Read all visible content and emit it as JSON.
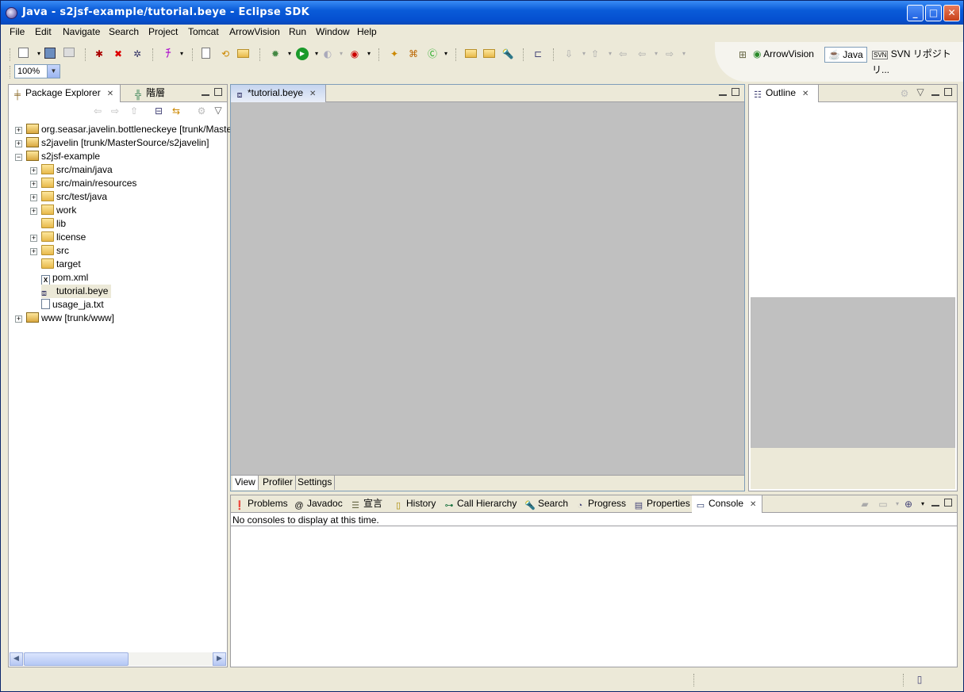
{
  "window": {
    "title": "Java - s2jsf-example/tutorial.beye - Eclipse SDK",
    "minimize": "_",
    "maximize": "□",
    "close": "✕"
  },
  "menu": [
    {
      "label": "File",
      "key": "F",
      "rest": "ile"
    },
    {
      "label": "Edit",
      "key": "E",
      "rest": "dit"
    },
    {
      "label": "Navigate",
      "key": "N",
      "rest": "avigate"
    },
    {
      "label": "Search",
      "key": "a",
      "pre": "Se",
      "rest": "rch"
    },
    {
      "label": "Project",
      "key": "P",
      "rest": "roject"
    },
    {
      "label": "Tomcat",
      "key": "T",
      "rest": "omcat"
    },
    {
      "label": "ArrowVision",
      "key": "",
      "rest": "ArrowVision"
    },
    {
      "label": "Run",
      "key": "R",
      "rest": "un"
    },
    {
      "label": "Window",
      "key": "W",
      "rest": "indow"
    },
    {
      "label": "Help",
      "key": "H",
      "rest": "elp"
    }
  ],
  "toolbar": {
    "zoom_value": "100%",
    "perspectives": {
      "arrowvision": "ArrowVision",
      "java": "Java",
      "svn": "SVN リポジトリ..."
    }
  },
  "package_explorer": {
    "tab_label": "Package Explorer",
    "hierarchy_tab_label": "階層",
    "tree": [
      {
        "label": "org.seasar.javelin.bottleneckeye [trunk/Maste",
        "expander": "+",
        "icon": "project"
      },
      {
        "label": "s2javelin [trunk/MasterSource/s2javelin]",
        "expander": "+",
        "icon": "project"
      },
      {
        "label": "s2jsf-example",
        "expander": "−",
        "icon": "project"
      },
      {
        "label": "src/main/java",
        "expander": "+",
        "icon": "pkgfolder"
      },
      {
        "label": "src/main/resources",
        "expander": "+",
        "icon": "pkgfolder"
      },
      {
        "label": "src/test/java",
        "expander": "+",
        "icon": "pkgfolder"
      },
      {
        "label": "work",
        "expander": "+",
        "icon": "pkgfolder"
      },
      {
        "label": "lib",
        "expander": "",
        "icon": "folder"
      },
      {
        "label": "license",
        "expander": "+",
        "icon": "folder"
      },
      {
        "label": "src",
        "expander": "+",
        "icon": "folder"
      },
      {
        "label": "target",
        "expander": "",
        "icon": "folder"
      },
      {
        "label": "pom.xml",
        "expander": "",
        "icon": "xml"
      },
      {
        "label": "tutorial.beye",
        "expander": "",
        "icon": "beye"
      },
      {
        "label": "usage_ja.txt",
        "expander": "",
        "icon": "txt"
      },
      {
        "label": "www [trunk/www]",
        "expander": "+",
        "icon": "project"
      }
    ]
  },
  "editor": {
    "tab_label": "*tutorial.beye",
    "bottom_tabs": [
      "View",
      "Profiler",
      "Settings"
    ]
  },
  "outline": {
    "tab_label": "Outline"
  },
  "bottom_panel": {
    "tabs": [
      "Problems",
      "Javadoc",
      "宣言",
      "History",
      "Call Hierarchy",
      "Search",
      "Progress",
      "Properties",
      "Console"
    ],
    "tab_icons": [
      "❗",
      "@",
      "☰",
      "▯",
      "⊶",
      "🔦",
      "◔",
      "▤",
      "▭"
    ],
    "console_message": "No consoles to display at this time."
  }
}
